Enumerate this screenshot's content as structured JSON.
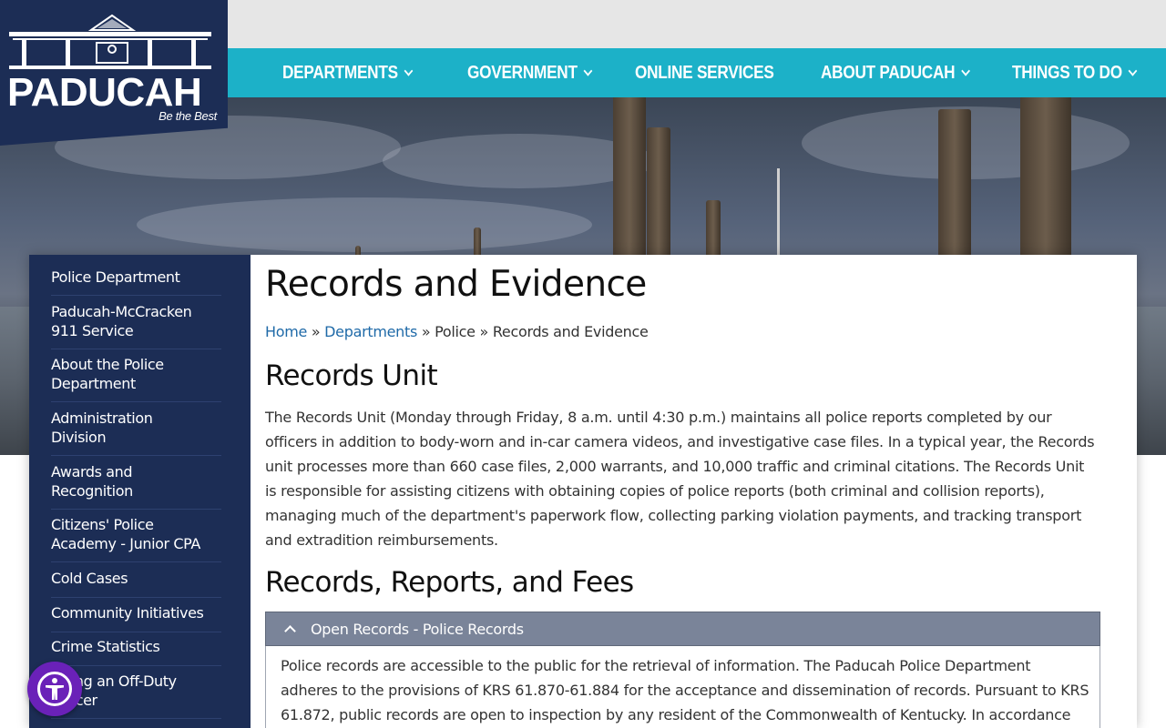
{
  "brand": {
    "name": "PADUCAH",
    "tagline": "Be the Best"
  },
  "nav": {
    "items": [
      {
        "label": "DEPARTMENTS",
        "has_dropdown": true
      },
      {
        "label": "GOVERNMENT",
        "has_dropdown": true
      },
      {
        "label": "ONLINE SERVICES",
        "has_dropdown": false
      },
      {
        "label": "ABOUT PADUCAH",
        "has_dropdown": true
      },
      {
        "label": "THINGS TO DO",
        "has_dropdown": true
      }
    ]
  },
  "sidebar": {
    "items": [
      {
        "line1": "Police Department",
        "line2": ""
      },
      {
        "line1": "Paducah-McCracken",
        "line2": "911 Service"
      },
      {
        "line1": "About the Police",
        "line2": "Department"
      },
      {
        "line1": "Administration",
        "line2": "Division"
      },
      {
        "line1": "Awards and",
        "line2": "Recognition"
      },
      {
        "line1": "Citizens' Police",
        "line2": "Academy - Junior CPA"
      },
      {
        "line1": "Cold Cases",
        "line2": ""
      },
      {
        "line1": "Community Initiatives",
        "line2": ""
      },
      {
        "line1": "Crime Statistics",
        "line2": ""
      },
      {
        "line1": "Hiring an Off-Duty",
        "line2": "Officer"
      }
    ]
  },
  "page": {
    "title": "Records and Evidence",
    "breadcrumb": {
      "home": "Home",
      "sep": "»",
      "departments": "Departments",
      "police": "Police",
      "current": "Records and Evidence"
    },
    "section1_heading": "Records Unit",
    "section1_text": "The Records Unit (Monday through Friday, 8 a.m. until 4:30 p.m.) maintains all police reports completed by our officers in addition to body-worn and in-car camera videos, and investigative case files. In a typical year, the Records unit processes more than 660 case files, 2,000 warrants, and 10,000 traffic and criminal citations. The Records Unit is responsible for assisting citizens with obtaining copies of police reports (both criminal and collision reports), managing much of the department's paperwork flow, collecting parking violation payments, and tracking transport and extradition reimbursements.",
    "section2_heading": "Records, Reports, and Fees",
    "accordion": {
      "title": "Open Records - Police Records",
      "body": "Police records are accessible to the public for the retrieval of information. The Paducah Police Department adheres to the provisions of KRS 61.870-61.884 for the acceptance and dissemination of records. Pursuant to KRS 61.872, public records are open to inspection by any resident of the Commonwealth of Kentucky. In accordance"
    }
  },
  "colors": {
    "navy": "#1c2d55",
    "teal": "#1cb1c8",
    "accordion": "#7a8499",
    "link": "#1f6aa8",
    "a11y": "#6a21b8"
  },
  "icons": {
    "accessibility": "accessibility-person-icon",
    "chevron_down": "chevron-down-icon",
    "chevron_up": "chevron-up-icon"
  }
}
